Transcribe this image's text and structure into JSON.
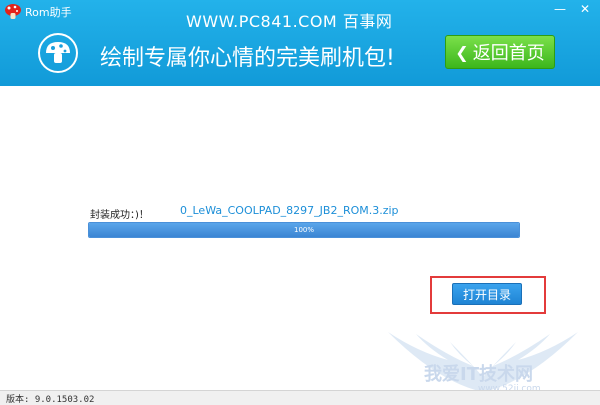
{
  "titlebar": {
    "app_name": "Rom助手",
    "minimize_label": "—",
    "close_label": "✕"
  },
  "watermark_top": "WWW.PC841.COM 百事网",
  "header": {
    "slogan": "绘制专属你心情的完美刷机包!",
    "back_button_label": "返回首页"
  },
  "main": {
    "status_label": "封装成功：)！",
    "file_name": "0_LeWa_COOLPAD_8297_JB2_ROM.3.zip",
    "progress": 100,
    "progress_text": "100%",
    "open_dir_label": "打开目录"
  },
  "statusbar": {
    "version": "版本: 9.0.1503.02"
  },
  "watermark_bottom": {
    "text": "我爱IT技术网",
    "url": "www.52ij.com"
  },
  "colors": {
    "header_blue": "#119ad8",
    "back_button_green": "#3cb61c",
    "progress_blue": "#3b85d3",
    "highlight_red": "#e33b3b",
    "file_link_blue": "#1d8fd8"
  },
  "icons": {
    "app_logo": "mushroom-icon",
    "header_logo": "mushroom-icon",
    "back": "chevron-left-icon"
  }
}
